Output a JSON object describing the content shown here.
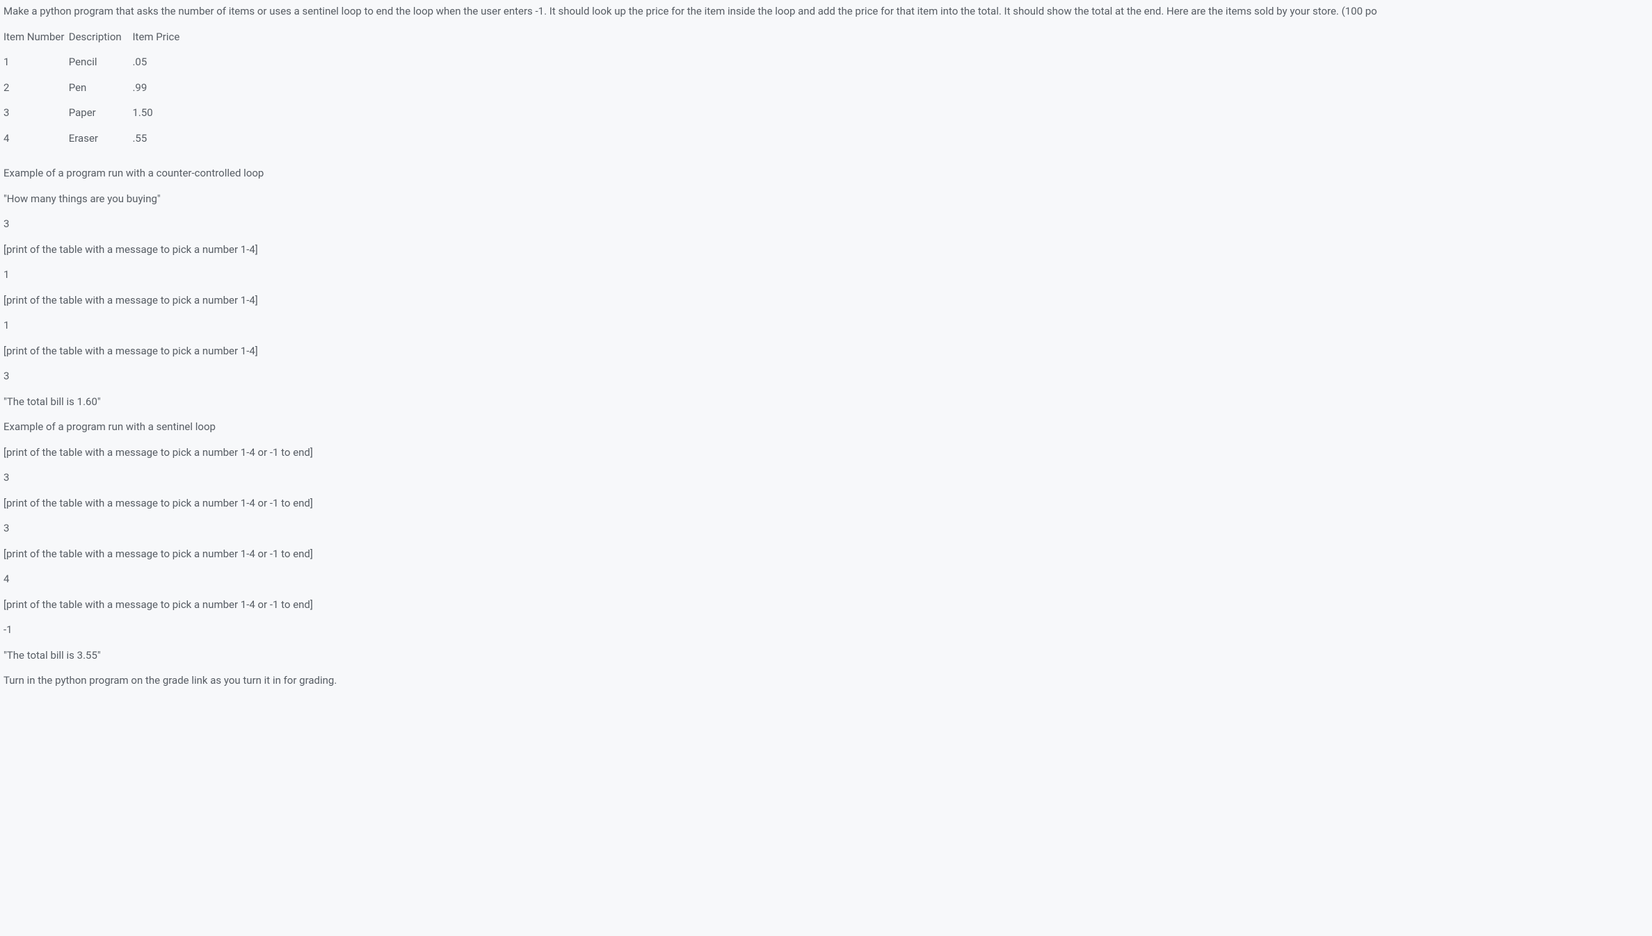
{
  "intro": "Make a python program that asks the number of items or uses a sentinel loop to end the loop when the user enters -1. It should look up the price for the item inside the loop and add the price for that item into the total. It should show the total at the end. Here are the items sold by your store. (100 po",
  "table": {
    "headers": {
      "number": "Item Number",
      "description": "Description",
      "price": "Item Price"
    },
    "rows": [
      {
        "number": "1",
        "description": "Pencil",
        "price": ".05"
      },
      {
        "number": "2",
        "description": "Pen",
        "price": ".99"
      },
      {
        "number": "3",
        "description": "Paper",
        "price": "1.50"
      },
      {
        "number": "4",
        "description": "Eraser",
        "price": ".55"
      }
    ]
  },
  "example1": {
    "title": "Example of a program run with a counter-controlled loop",
    "prompt": "\"How many things are you buying\"",
    "input1": "3",
    "msg1": "[print of the table with a message to pick a number 1-4]",
    "input2": "1",
    "msg2": "[print of the table with a message to pick a number 1-4]",
    "input3": "1",
    "msg3": "[print of the table with a message to pick a number 1-4]",
    "input4": "3",
    "result": "\"The total bill is 1.60\""
  },
  "example2": {
    "title": "Example of a program run with a sentinel loop",
    "msg1": "[print of the table with a message to pick a number 1-4 or -1 to end]",
    "input1": "3",
    "msg2": "[print of the table with a message to pick a number 1-4 or -1 to end]",
    "input2": "3",
    "msg3": "[print of the table with a message to pick a number 1-4 or -1 to end]",
    "input3": "4",
    "msg4": "[print of the table with a message to pick a number 1-4 or -1 to end]",
    "input4": "-1",
    "result": "\"The total bill is 3.55\""
  },
  "footer": "Turn in the python program on the grade link as you turn it in for grading."
}
